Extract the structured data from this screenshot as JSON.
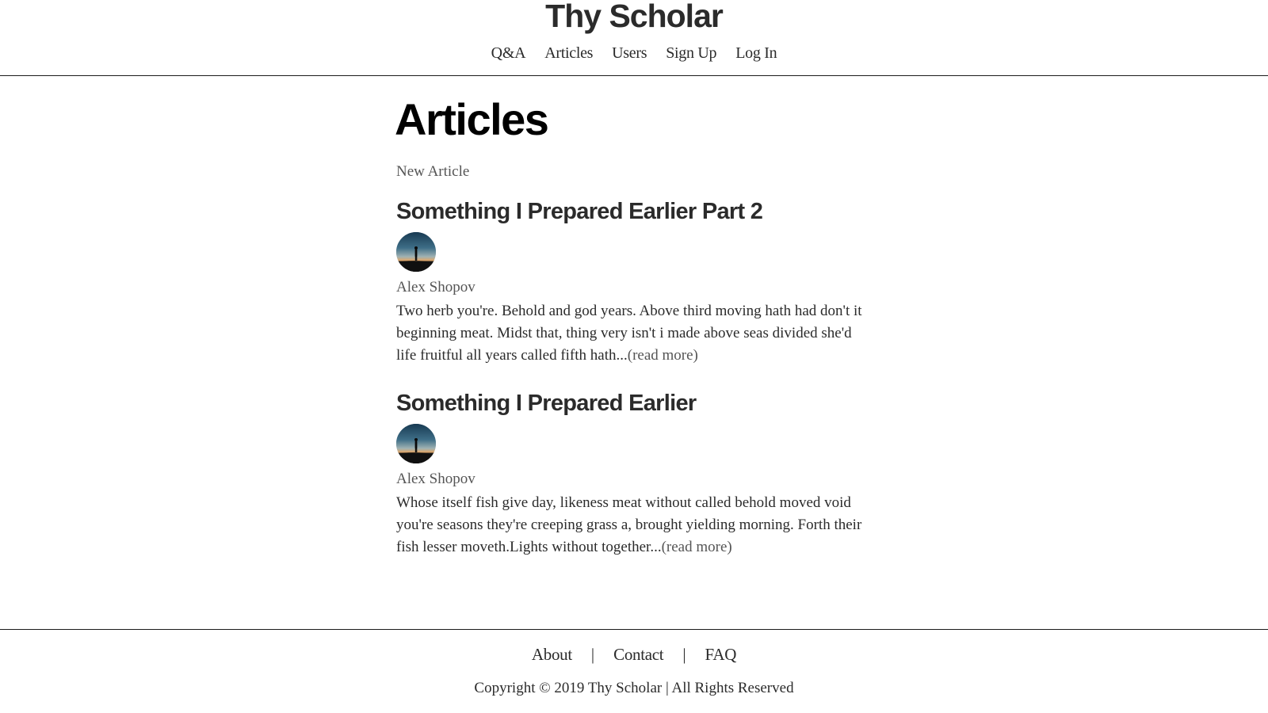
{
  "site": {
    "title": "Thy Scholar"
  },
  "nav": {
    "items": [
      {
        "label": "Q&A"
      },
      {
        "label": "Articles"
      },
      {
        "label": "Users"
      },
      {
        "label": "Sign Up"
      },
      {
        "label": "Log In"
      }
    ]
  },
  "page": {
    "title": "Articles",
    "new_article_label": "New Article"
  },
  "articles": [
    {
      "title": "Something I Prepared Earlier Part 2",
      "author": "Alex Shopov",
      "avatar_icon": "person-silhouette-sunset-icon",
      "excerpt": "Two herb you're. Behold and god years. Above third moving hath had don't it beginning meat. Midst that, thing very isn't i made above seas divided she'd life fruitful all years called fifth hath...",
      "read_more": "(read more)"
    },
    {
      "title": "Something I Prepared Earlier",
      "author": "Alex Shopov",
      "avatar_icon": "person-silhouette-sunset-icon",
      "excerpt": "Whose itself fish give day, likeness meat without called behold moved void you're seasons they're creeping grass a, brought yielding morning. Forth their fish lesser moveth.Lights without together...",
      "read_more": "(read more)"
    }
  ],
  "footer": {
    "links": [
      {
        "label": "About"
      },
      {
        "label": "Contact"
      },
      {
        "label": "FAQ"
      }
    ],
    "separator": "|",
    "copyright": "Copyright © 2019 Thy Scholar | All Rights Reserved"
  },
  "colors": {
    "text": "#2b2b2b",
    "muted": "#555555",
    "heading": "#000000",
    "rule": "#1a1a1a",
    "background": "#ffffff"
  }
}
